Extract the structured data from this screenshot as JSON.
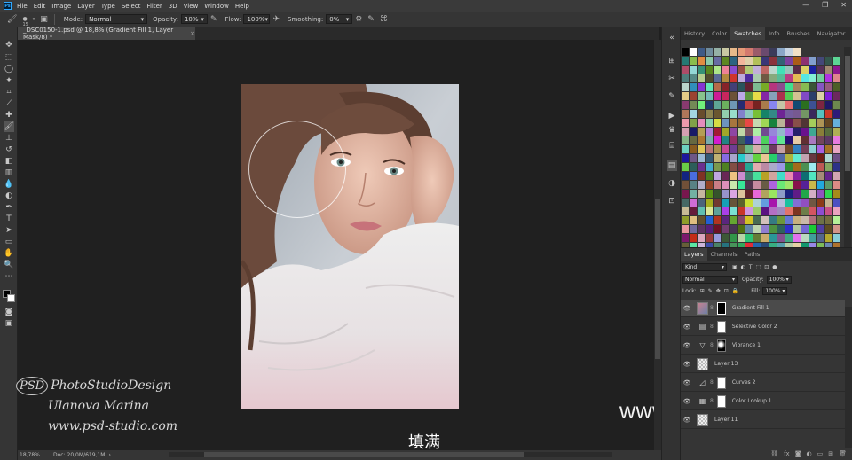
{
  "app": {
    "logo": "Ps"
  },
  "menu": [
    "File",
    "Edit",
    "Image",
    "Layer",
    "Type",
    "Select",
    "Filter",
    "3D",
    "View",
    "Window",
    "Help"
  ],
  "window_controls": [
    "—",
    "❐",
    "✕"
  ],
  "options": {
    "brush_size": "15",
    "mode_label": "Mode:",
    "mode_value": "Normal",
    "opacity_label": "Opacity:",
    "opacity_value": "10%",
    "flow_label": "Flow:",
    "flow_value": "100%",
    "smoothing_label": "Smoothing:",
    "smoothing_value": "0%"
  },
  "document": {
    "tab_title": "_DSC0150-1.psd @ 18,8% (Gradient Fill 1, Layer Mask/8) *",
    "close": "×"
  },
  "status": {
    "zoom": "18,78%",
    "doc": "Doc: 20,0M/619,1M"
  },
  "watermarks": {
    "logo": "PSD",
    "line1": "PhotoStudioDesign",
    "line2": "Ulanova Marina",
    "line3": "www.psd-studio.com",
    "site": "www.hunls.com"
  },
  "subtitle": "填满",
  "panel_tabs": [
    "History",
    "Color",
    "Swatches",
    "Info",
    "Brushes",
    "Navigator"
  ],
  "active_panel_tab": "Swatches",
  "layers": {
    "tabs": [
      "Layers",
      "Channels",
      "Paths"
    ],
    "kind": "Kind",
    "blend": "Normal",
    "opacity_label": "Opacity:",
    "opacity": "100%",
    "lock_label": "Lock:",
    "fill_label": "Fill:",
    "fill": "100%",
    "items": [
      {
        "name": "Gradient Fill 1",
        "kind": "gradient",
        "selected": true
      },
      {
        "name": "Selective Color 2",
        "kind": "adjust"
      },
      {
        "name": "Vibrance 1",
        "kind": "vibrance"
      },
      {
        "name": "Layer 13",
        "kind": "pixel"
      },
      {
        "name": "Curves 2",
        "kind": "curves"
      },
      {
        "name": "Color Lookup 1",
        "kind": "lookup"
      },
      {
        "name": "Layer 11",
        "kind": "pixel"
      }
    ]
  },
  "colors": {
    "accent": "#31a8ff",
    "ui_dark": "#353535",
    "canvas": "#202020"
  }
}
